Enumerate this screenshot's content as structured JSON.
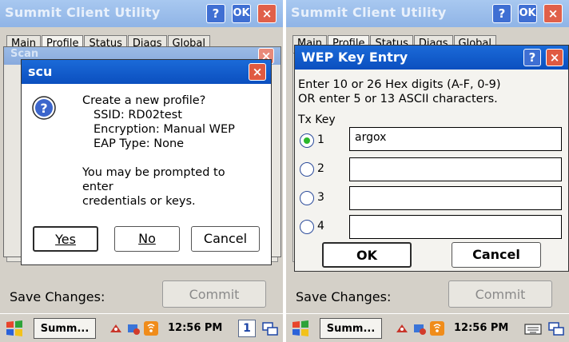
{
  "left": {
    "window_title": "Summit Client Utility",
    "help_label": "?",
    "ok_label": "OK",
    "close_label": "×",
    "tabs": [
      "Main",
      "Profile",
      "Status",
      "Diags",
      "Global"
    ],
    "underlay_title": "Scan",
    "dialog": {
      "title": "scu",
      "close_label": "×",
      "lines": [
        "Create a new profile?",
        "SSID: RD02test",
        "Encryption: Manual WEP",
        "EAP Type: None",
        "",
        "You may be prompted to",
        "enter",
        "credentials or keys."
      ],
      "yes_label": "Yes",
      "no_label": "No",
      "cancel_label": "Cancel"
    },
    "save_label": "Save Changes:",
    "commit_label": "Commit",
    "taskbar": {
      "task_label": "Summ...",
      "clock": "12:56 PM",
      "desk_num": "1"
    }
  },
  "right": {
    "window_title": "Summit Client Utility",
    "help_label": "?",
    "ok_label": "OK",
    "close_label": "×",
    "tabs": [
      "Main",
      "Profile",
      "Status",
      "Diags",
      "Global"
    ],
    "dialog": {
      "title": "WEP Key Entry",
      "help_label": "?",
      "close_label": "×",
      "instructions": [
        "Enter 10 or 26 Hex digits (A-F, 0-9)",
        "OR enter 5 or 13 ASCII characters."
      ],
      "tx_key_label": "Tx Key",
      "keys": [
        {
          "num": "1",
          "value": "argox",
          "selected": true
        },
        {
          "num": "2",
          "value": "",
          "selected": false
        },
        {
          "num": "3",
          "value": "",
          "selected": false
        },
        {
          "num": "4",
          "value": "",
          "selected": false
        }
      ],
      "ok_label": "OK",
      "cancel_label": "Cancel"
    },
    "save_label": "Save Changes:",
    "commit_label": "Commit",
    "taskbar": {
      "task_label": "Summ...",
      "clock": "12:56 PM"
    }
  }
}
